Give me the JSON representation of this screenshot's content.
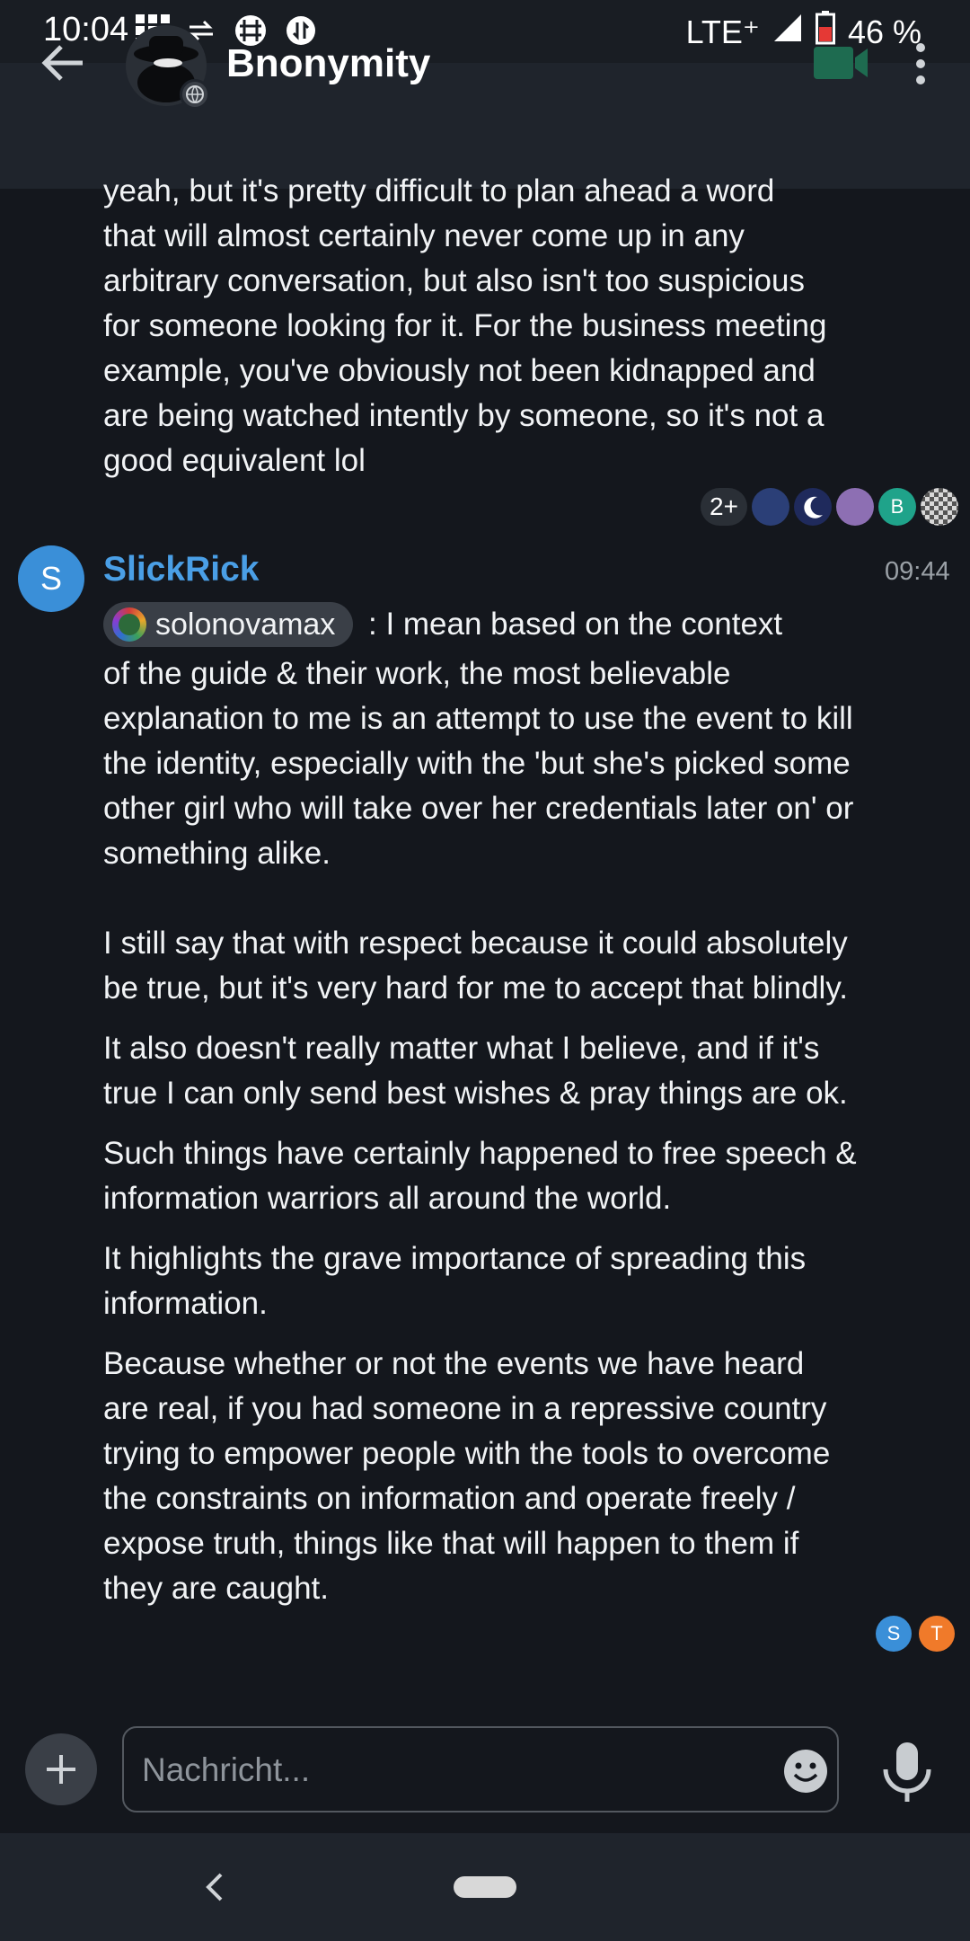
{
  "status_bar": {
    "time": "10:04",
    "network": "LTE⁺",
    "battery": "46 %"
  },
  "header": {
    "title": "Bnonymity"
  },
  "messages": {
    "previous": {
      "text": "yeah, but it's pretty difficult to plan ahead a word\nthat will almost certainly never come up in any\narbitrary conversation, but also isn't too suspicious\nfor someone looking for it. For the business meeting\nexample, you've obviously not been kidnapped and\nare being watched intently by someone, so it's not a\ngood equivalent lol",
      "reactions_count": "2+",
      "reaction_avatars": [
        {
          "letter": "",
          "color": "#2b3f77"
        },
        {
          "letter": "",
          "color": "#1f2a5c"
        },
        {
          "letter": "",
          "color": "#8d6fb3"
        },
        {
          "letter": "B",
          "color": "#1fa38a"
        },
        {
          "letter": "",
          "color": "#cfcfcf"
        }
      ]
    },
    "current": {
      "sender_initial": "S",
      "sender_name": "SlickRick",
      "time": "09:44",
      "mention": "solonovamax",
      "first_line": ": I mean based on the context",
      "para1": "of the guide & their work, the most believable\nexplanation to me is an attempt to use the event to kill\nthe identity, especially with the 'but she's picked some\nother girl who will take over her credentials later on' or\nsomething alike.\n\nI still say that with respect because it could absolutely\nbe true, but it's very hard for me to accept that blindly.",
      "para2": "It also doesn't really matter what I believe, and if it's\ntrue I can only send best wishes & pray things are ok.",
      "para3": "Such things have certainly happened to free speech &\ninformation warriors all around the world.",
      "para4": "It highlights the grave importance of spreading this\ninformation.",
      "para5": "Because whether or not the events we have heard\nare real, if you had someone in a repressive country\ntrying to empower people with the tools to overcome\nthe constraints on information and operate freely /\nexpose truth, things like that will happen to them if\nthey are caught.",
      "read_receipts": [
        {
          "letter": "S",
          "color": "#3a8fd8"
        },
        {
          "letter": "T",
          "color": "#f07a2a"
        }
      ]
    }
  },
  "composer": {
    "placeholder": "Nachricht..."
  },
  "colors": {
    "background": "#14171d",
    "app_bar": "#1f242c",
    "accent_name": "#4a9fe6",
    "video_icon": "#1e6b50"
  }
}
